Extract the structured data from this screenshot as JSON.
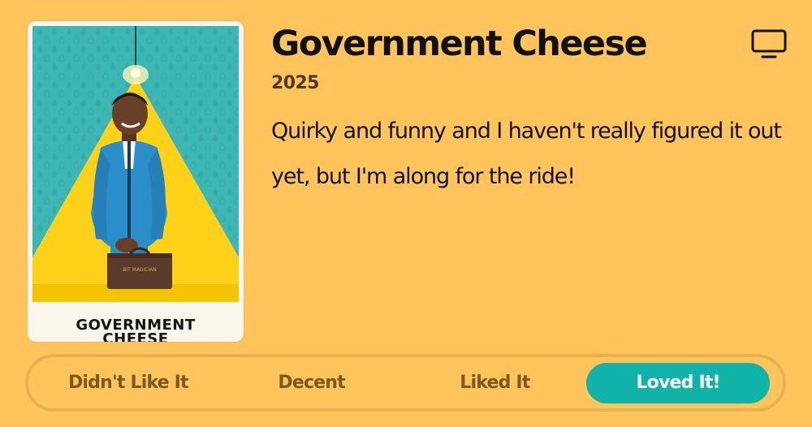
{
  "show": {
    "title": "Government Cheese",
    "year": "2025",
    "review": "Quirky and funny and I haven't really figured it out yet, but I'm along for the ride!",
    "poster": {
      "title_line1": "GOVERNMENT",
      "title_line2": "CHEESE",
      "briefcase_text": "BIT MAGICIAN"
    }
  },
  "icons": {
    "media_type": "tv-icon"
  },
  "ratings": {
    "options": [
      "Didn't Like It",
      "Decent",
      "Liked It",
      "Loved It!"
    ],
    "selected": "Loved It!"
  },
  "colors": {
    "background": "#FFC45C",
    "selected_rating": "#11B3A9",
    "poster_teal": "#3BB3B4",
    "poster_yellow": "#FFD21A",
    "suit_blue": "#2A8EC9"
  }
}
